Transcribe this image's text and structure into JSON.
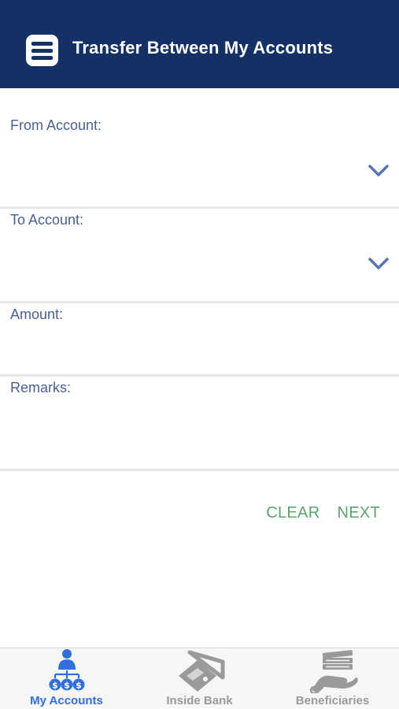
{
  "header": {
    "title": "Transfer Between My Accounts",
    "menu_icon": "hamburger-menu-icon",
    "background": "#143166"
  },
  "form": {
    "from_account": {
      "label": "From Account:",
      "value": ""
    },
    "to_account": {
      "label": "To Account:",
      "value": ""
    },
    "amount": {
      "label": "Amount:",
      "value": ""
    },
    "remarks": {
      "label": "Remarks:",
      "value": ""
    }
  },
  "actions": {
    "clear_label": "CLEAR",
    "next_label": "NEXT",
    "color": "#5aa36a"
  },
  "tabs": [
    {
      "label": "My Accounts",
      "icon": "my-accounts-icon",
      "active": true
    },
    {
      "label": "Inside Bank",
      "icon": "inside-bank-icon",
      "active": false
    },
    {
      "label": "Beneficiaries",
      "icon": "beneficiaries-icon",
      "active": false
    }
  ],
  "colors": {
    "label_text": "#4a5f93",
    "chevron": "#5b74b0",
    "tab_active": "#2f6fe0",
    "tab_inactive": "#9a9a9a"
  }
}
